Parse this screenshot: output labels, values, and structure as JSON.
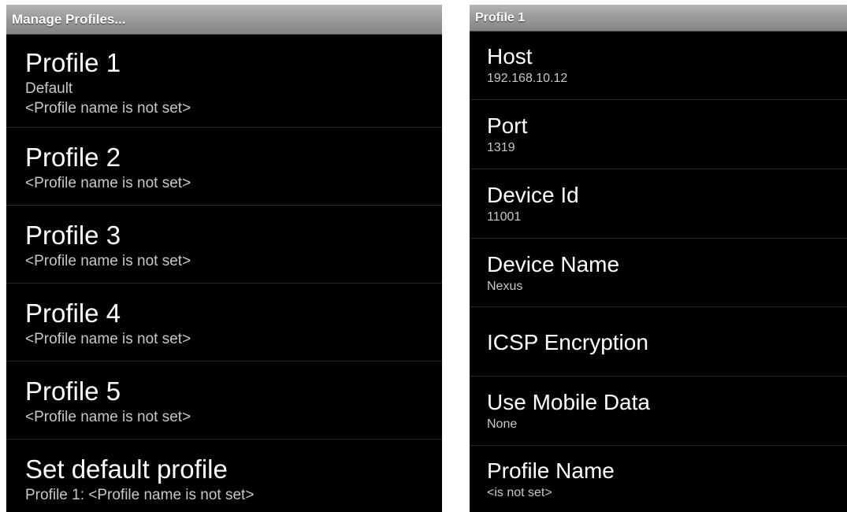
{
  "left": {
    "title": "Manage Profiles...",
    "items": [
      {
        "title": "Profile 1",
        "lines": [
          "Default",
          "<Profile name is not set>"
        ]
      },
      {
        "title": "Profile 2",
        "lines": [
          "<Profile name is not set>"
        ]
      },
      {
        "title": "Profile 3",
        "lines": [
          "<Profile name is not set>"
        ]
      },
      {
        "title": "Profile 4",
        "lines": [
          "<Profile name is not set>"
        ]
      },
      {
        "title": "Profile 5",
        "lines": [
          "<Profile name is not set>"
        ]
      },
      {
        "title": "Set default profile",
        "lines": [
          "Profile 1: <Profile name is not set>"
        ]
      }
    ]
  },
  "right": {
    "title": "Profile 1",
    "items": [
      {
        "title": "Host",
        "summary": "192.168.10.12"
      },
      {
        "title": "Port",
        "summary": "1319"
      },
      {
        "title": "Device Id",
        "summary": "11001"
      },
      {
        "title": "Device Name",
        "summary": "Nexus"
      },
      {
        "title": "ICSP Encryption",
        "summary": ""
      },
      {
        "title": "Use Mobile Data",
        "summary": "None"
      },
      {
        "title": "Profile Name",
        "summary": "<is not set>"
      }
    ]
  }
}
